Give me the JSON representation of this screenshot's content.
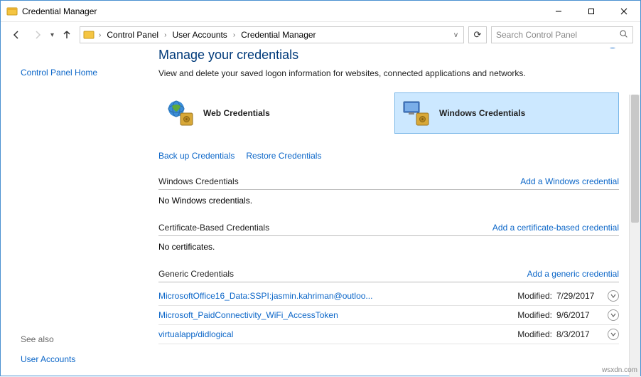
{
  "window": {
    "title": "Credential Manager"
  },
  "nav": {
    "segments": [
      "Control Panel",
      "User Accounts",
      "Credential Manager"
    ],
    "search_placeholder": "Search Control Panel"
  },
  "sidebar": {
    "home": "Control Panel Home",
    "see_also": "See also",
    "user_accounts": "User Accounts"
  },
  "main": {
    "heading": "Manage your credentials",
    "subtitle": "View and delete your saved logon information for websites, connected applications and networks.",
    "tiles": {
      "web": "Web Credentials",
      "windows": "Windows Credentials"
    },
    "actions": {
      "backup": "Back up Credentials",
      "restore": "Restore Credentials"
    },
    "sections": {
      "windows": {
        "title": "Windows Credentials",
        "add": "Add a Windows credential",
        "empty": "No Windows credentials."
      },
      "cert": {
        "title": "Certificate-Based Credentials",
        "add": "Add a certificate-based credential",
        "empty": "No certificates."
      },
      "generic": {
        "title": "Generic Credentials",
        "add": "Add a generic credential",
        "modified_label": "Modified:",
        "items": [
          {
            "name": "MicrosoftOffice16_Data:SSPI:jasmin.kahriman@outloo...",
            "date": "7/29/2017"
          },
          {
            "name": "Microsoft_PaidConnectivity_WiFi_AccessToken",
            "date": "9/6/2017"
          },
          {
            "name": "virtualapp/didlogical",
            "date": "8/3/2017"
          }
        ]
      }
    }
  },
  "watermark": "wsxdn.com"
}
